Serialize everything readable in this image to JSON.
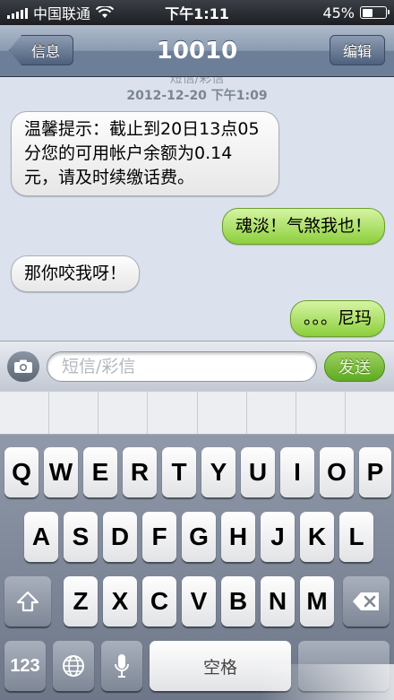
{
  "status_bar": {
    "carrier": "中国联通",
    "time": "下午1:11",
    "battery_percent": "45%",
    "battery_level": 0.45,
    "signal_icon": "signal-bars-icon",
    "wifi_icon": "wifi-icon",
    "battery_icon": "battery-icon"
  },
  "nav": {
    "back_label": "信息",
    "title": "10010",
    "edit_label": "编辑"
  },
  "thread": {
    "sender_label": "短信/彩信",
    "timestamp": "2012-12-20 下午1:09",
    "messages": [
      {
        "direction": "incoming",
        "text": "温馨提示：截止到20日13点05分您的可用帐户余额为0.14元，请及时续缴话费。"
      },
      {
        "direction": "outgoing",
        "text": "魂淡！气煞我也！"
      },
      {
        "direction": "incoming",
        "text": "那你咬我呀！"
      },
      {
        "direction": "outgoing",
        "text": "。。。尼玛"
      }
    ]
  },
  "composer": {
    "camera_icon": "camera-icon",
    "placeholder": "短信/彩信",
    "value": "",
    "send_label": "发送"
  },
  "keyboard": {
    "row1": [
      "Q",
      "W",
      "E",
      "R",
      "T",
      "Y",
      "U",
      "I",
      "O",
      "P"
    ],
    "row2": [
      "A",
      "S",
      "D",
      "F",
      "G",
      "H",
      "J",
      "K",
      "L"
    ],
    "row3": [
      "Z",
      "X",
      "C",
      "V",
      "B",
      "N",
      "M"
    ],
    "shift_icon": "shift-arrow-icon",
    "delete_icon": "backspace-icon",
    "numbers_label": "123",
    "globe_icon": "globe-icon",
    "mic_icon": "microphone-icon",
    "space_label": "空格"
  },
  "colors": {
    "incoming_bubble": "#f2f2f2",
    "outgoing_bubble": "#a8dc63",
    "thread_bg": "#dbe2ed",
    "nav_bar": "#8a9ab0"
  }
}
